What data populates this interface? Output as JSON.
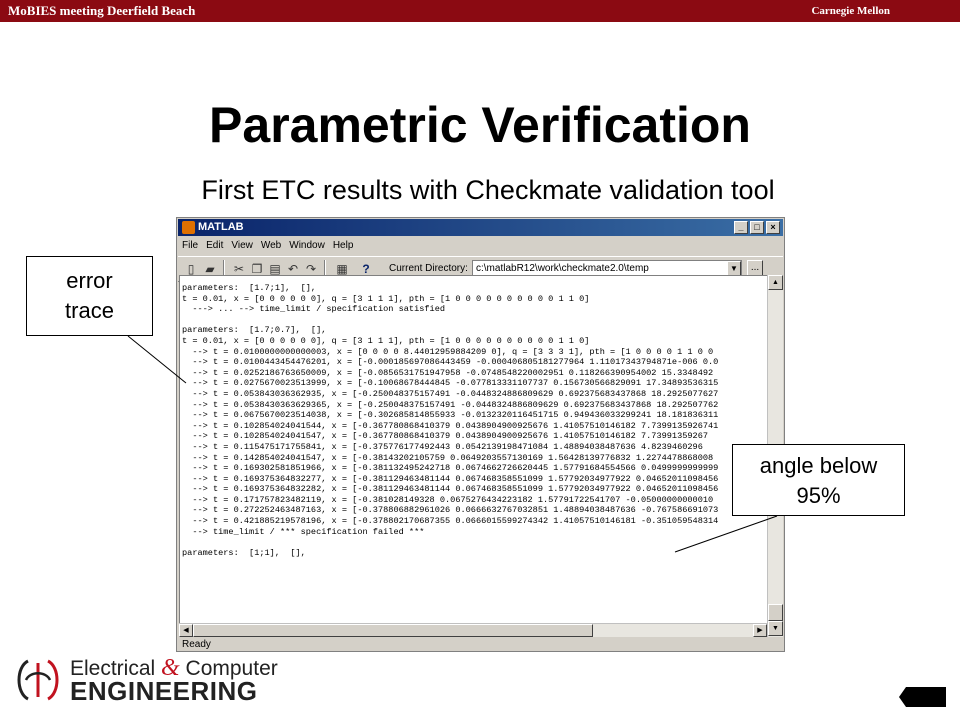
{
  "header": {
    "event": "MoBIES meeting Deerfield Beach",
    "university": "Carnegie Mellon"
  },
  "slide": {
    "title": "Parametric Verification",
    "subtitle": "First ETC results with Checkmate validation tool"
  },
  "matlab": {
    "window_title": "MATLAB",
    "menu": [
      "File",
      "Edit",
      "View",
      "Web",
      "Window",
      "Help"
    ],
    "toolbar": {
      "current_directory_label": "Current Directory:",
      "current_directory_value": "c:\\matlabR12\\work\\checkmate2.0\\temp",
      "browse_label": "..."
    },
    "console_lines": [
      "parameters:  [1.7;1],  [],",
      "t = 0.01, x = [0 0 0 0 0 0], q = [3 1 1 1], pth = [1 0 0 0 0 0 0 0 0 0 0 1 1 0]",
      "  ---> ... --> time_limit / specification satisfied",
      "",
      "parameters:  [1.7;0.7],  [],",
      "t = 0.01, x = [0 0 0 0 0 0], q = [3 1 1 1], pth = [1 0 0 0 0 0 0 0 0 0 0 1 1 0]",
      "  --> t = 0.0100000000000003, x = [0 0 0 0 8.44012959884209 0], q = [3 3 3 1], pth = [1 0 0 0 0 1 1 0 0",
      "  --> t = 0.0100443454476201, x = [-0.000185697086443459 -0.000406805181277964 1.11017343794871e-006 0.0",
      "  --> t = 0.0252186763650009, x = [-0.0856531751947958 -0.0748548220002951 0.118266390954002 15.3348492",
      "  --> t = 0.0275670023513999, x = [-0.10068678444845 -0.077813331107737 0.156730566829091 17.34893536315",
      "  --> t = 0.053843036362935, x = [-0.250048375157491 -0.0448324886809629 0.692375683437868 18.2925077627",
      "  --> t = 0.0538430363629365, x = [-0.250048375157491 -0.0448324886809629 0.692375683437868 18.292507762",
      "  --> t = 0.0675670023514038, x = [-0.302685814855933 -0.0132320116451715 0.949436033299241 18.181836311",
      "  --> t = 0.102854024041544, x = [-0.367780868410379 0.0438904900925676 1.41057510146182 7.7399135926741",
      "  --> t = 0.102854024041547, x = [-0.367780868410379 0.0438904900925676 1.41057510146182 7.73991359267",
      "  --> t = 0.115475171755841, x = [-0.375776177492443 0.0542139198471084 1.48894038487636 4.8239460296",
      "  --> t = 0.142854024041547, x = [-0.38143202105759 0.0649203557130169 1.56428139776832 1.2274478868008",
      "  --> t = 0.169302581851966, x = [-0.381132495242718 0.0674662726620445 1.57791684554566 0.0499999999999",
      "  --> t = 0.169375364832277, x = [-0.381129463481144 0.067468358551099 1.57792034977922 0.04652011098456",
      "  --> t = 0.169375364832282, x = [-0.381129463481144 0.067468358551099 1.57792034977922 0.04652011098456",
      "  --> t = 0.171757823482119, x = [-0.381028149328 0.0675276434223182 1.57791722541707 -0.05000000000010",
      "  --> t = 0.272252463487163, x = [-0.378806882961026 0.0666632767032851 1.48894038487636 -0.767586691073",
      "  --> t = 0.421885219578196, x = [-0.378802170687355 0.0666015599274342 1.41057510146181 -0.351059548314",
      "  --> time_limit / *** specification failed ***",
      "",
      "parameters:  [1;1],  [],"
    ],
    "status": "Ready"
  },
  "callouts": {
    "error_trace": [
      "error",
      "trace"
    ],
    "angle": [
      "angle below",
      "95%"
    ]
  },
  "logo": {
    "line1_a": "Electrical ",
    "line1_amp": "&",
    "line1_b": " Computer",
    "line2": "ENGINEERING"
  },
  "icons": [
    "new-file-icon",
    "open-folder-icon",
    "cut-icon",
    "copy-icon",
    "paste-icon",
    "undo-icon",
    "redo-icon",
    "simulink-icon",
    "help-icon"
  ],
  "colors": {
    "banner": "#8b0a12",
    "titlebar": "#0a246a",
    "accent": "#c1121f"
  }
}
